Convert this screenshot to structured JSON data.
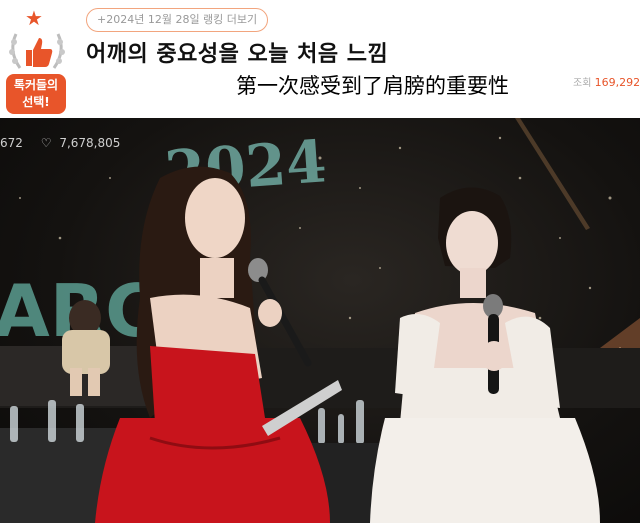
{
  "post": {
    "badge_label": "톡커들의\n선택!",
    "date_tag": "+2024년 12월 28일 랭킹 더보기",
    "title_ko": "어깨의 중요성을 오늘 처음 느낌",
    "title_zh": "第一次感受到了肩膀的重要性",
    "views_label": "조회",
    "views_count": "169,292"
  },
  "photo": {
    "event_text": "2024",
    "left_stat": "672",
    "likes": "7,678,805",
    "stage_letters": "ARC"
  },
  "colors": {
    "accent": "#e8552a",
    "red_dress": "#c8141c",
    "white_dress": "#f1ece6"
  }
}
